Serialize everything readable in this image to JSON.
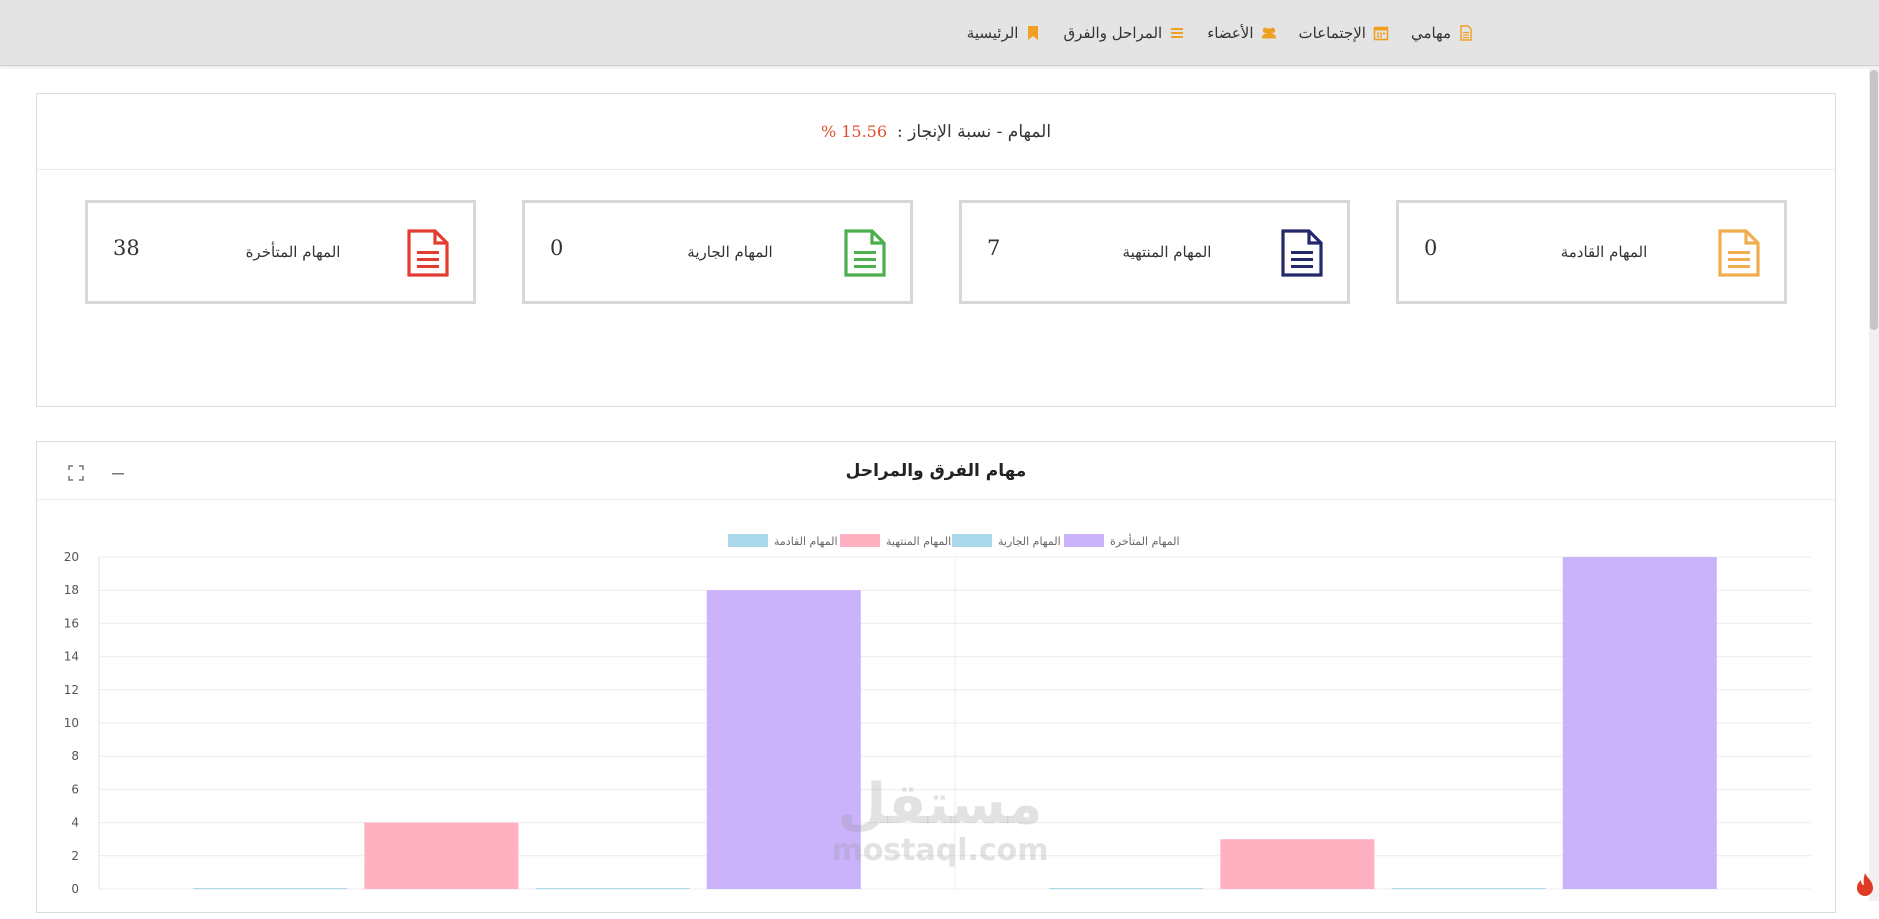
{
  "navbar": {
    "items": [
      {
        "label": "الرئيسية",
        "icon": "bookmark-icon"
      },
      {
        "label": "المراحل والفرق",
        "icon": "list-icon"
      },
      {
        "label": "الأعضاء",
        "icon": "users-icon"
      },
      {
        "label": "الإجتماعات",
        "icon": "calendar-icon"
      },
      {
        "label": "مهامي",
        "icon": "file-icon"
      }
    ],
    "icon_color": "#f0a020"
  },
  "tasks_panel": {
    "title": "المهام - نسبة الإنجاز :",
    "percentage": "15.56 %",
    "cards": [
      {
        "label": "المهام القادمة",
        "value": "0",
        "color": "#f0ad4e"
      },
      {
        "label": "المهام المنتهية",
        "value": "7",
        "color": "#23286b"
      },
      {
        "label": "المهام الجارية",
        "value": "0",
        "color": "#4cae4c"
      },
      {
        "label": "المهام المتأخرة",
        "value": "38",
        "color": "#e23d30"
      }
    ]
  },
  "chart_panel": {
    "title": "مهام الفرق والمراحل"
  },
  "chart_data": {
    "type": "bar",
    "title": "مهام الفرق والمراحل",
    "categories": [
      "",
      ""
    ],
    "series": [
      {
        "name": "المهام القادمة",
        "values": [
          0,
          0
        ],
        "color": "#a9d8ea"
      },
      {
        "name": "المهام المنتهية",
        "values": [
          4,
          3
        ],
        "color": "#ffb1c1"
      },
      {
        "name": "المهام الجارية",
        "values": [
          0,
          0
        ],
        "color": "#a9d8ea"
      },
      {
        "name": "المهام المتأخرة",
        "values": [
          18,
          20
        ],
        "color": "#cab3fb"
      }
    ],
    "ylim": [
      0,
      20
    ],
    "yticks": [
      0,
      2,
      4,
      6,
      8,
      10,
      12,
      14,
      16,
      18,
      20
    ],
    "legend": "top-center",
    "grid": true
  },
  "watermark": {
    "arabic": "مستقل",
    "latin": "mostaql.com"
  }
}
